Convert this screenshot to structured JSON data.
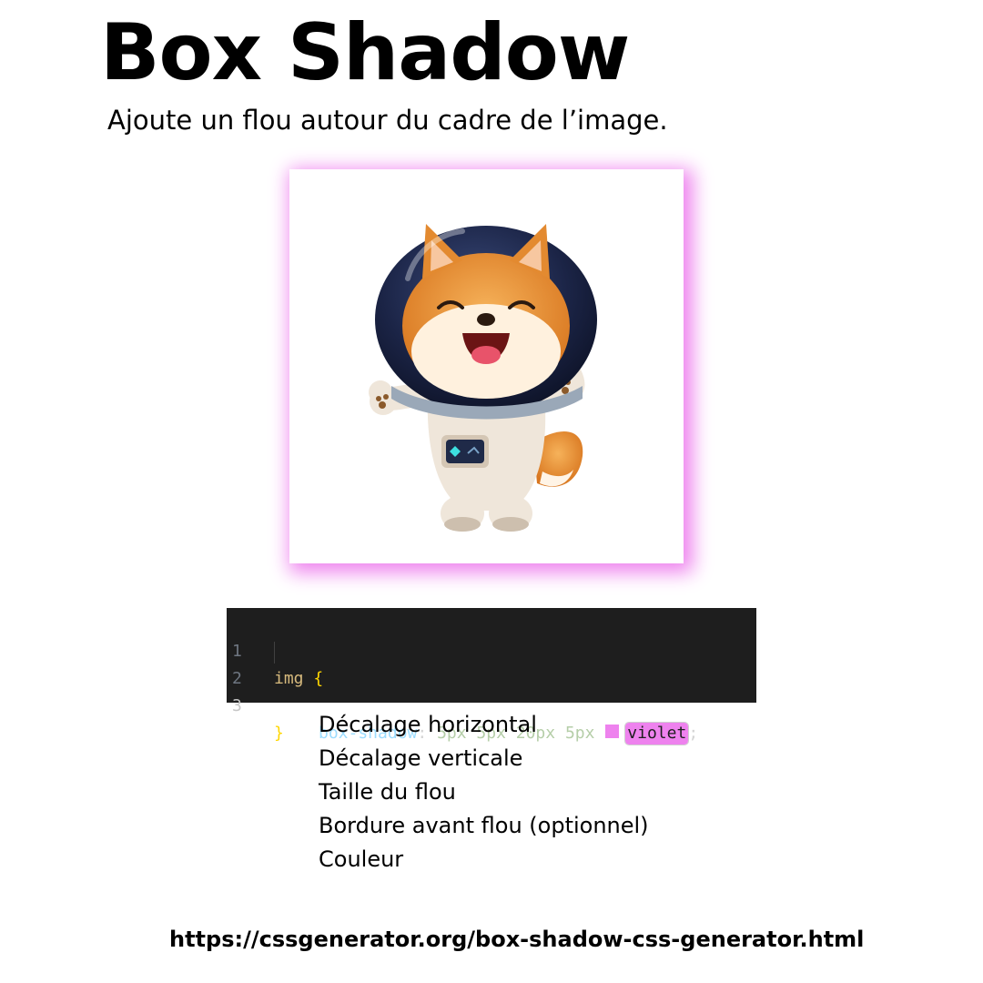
{
  "header": {
    "title": "Box Shadow",
    "subtitle": "Ajoute un flou autour du cadre de l’image."
  },
  "illustration": {
    "subject": "shiba-astronaut-illustration",
    "shadow_color": "#ee82ee"
  },
  "code": {
    "line_numbers": [
      "1",
      "2",
      "3"
    ],
    "selector": "img",
    "open_brace": "{",
    "property": "box-shadow",
    "colon": ":",
    "values": "5px 5px 20px 5px",
    "color_value": "violet",
    "color_swatch": "#ee82ee",
    "semicolon": ";",
    "close_brace": "}"
  },
  "legend": {
    "items": [
      "Décalage horizontal",
      "Décalage verticale",
      "Taille du flou",
      "Bordure avant flou (optionnel)",
      "Couleur"
    ]
  },
  "footer": {
    "url": "https://cssgenerator.org/box-shadow-css-generator.html"
  }
}
